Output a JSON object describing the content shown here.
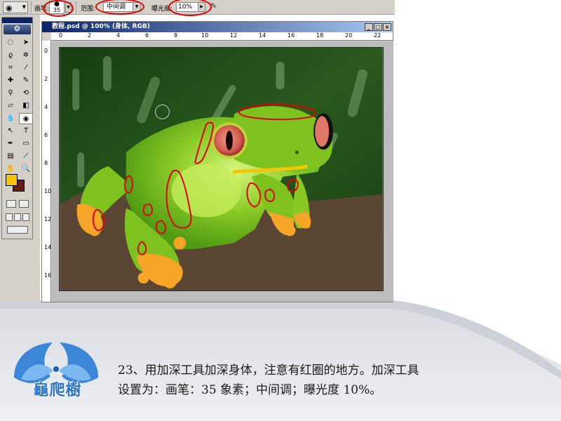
{
  "options_bar": {
    "brush_label": "画笔:",
    "brush_size": "35",
    "range_label": "范围:",
    "range_value": "中间调",
    "exposure_label": "曝光度:",
    "exposure_value": "10%"
  },
  "toolbox": {
    "foreground_color": "#f6c20a",
    "background_color": "#6b1a10"
  },
  "document": {
    "title": "教程.psd @ 100% (身体, RGB)",
    "ruler_h": [
      "0",
      "2",
      "4",
      "6",
      "8",
      "10",
      "12",
      "14",
      "16",
      "18",
      "20",
      "22"
    ],
    "ruler_v": [
      "0",
      "2",
      "4",
      "6",
      "8",
      "10",
      "12",
      "14",
      "16"
    ]
  },
  "caption": {
    "line1": "23、用加深工具加深身体，注意有红圈的地方。加深工具",
    "line2": "设置为：画笔：35 象素；中间调；曝光度 10%。"
  },
  "logo": {
    "text": "龜爬樹"
  },
  "colors": {
    "leaf_green": "#1a4a14",
    "frog_green": "#7dc21e",
    "branch_brown": "#5a4632",
    "annotation_red": "#e00000"
  }
}
